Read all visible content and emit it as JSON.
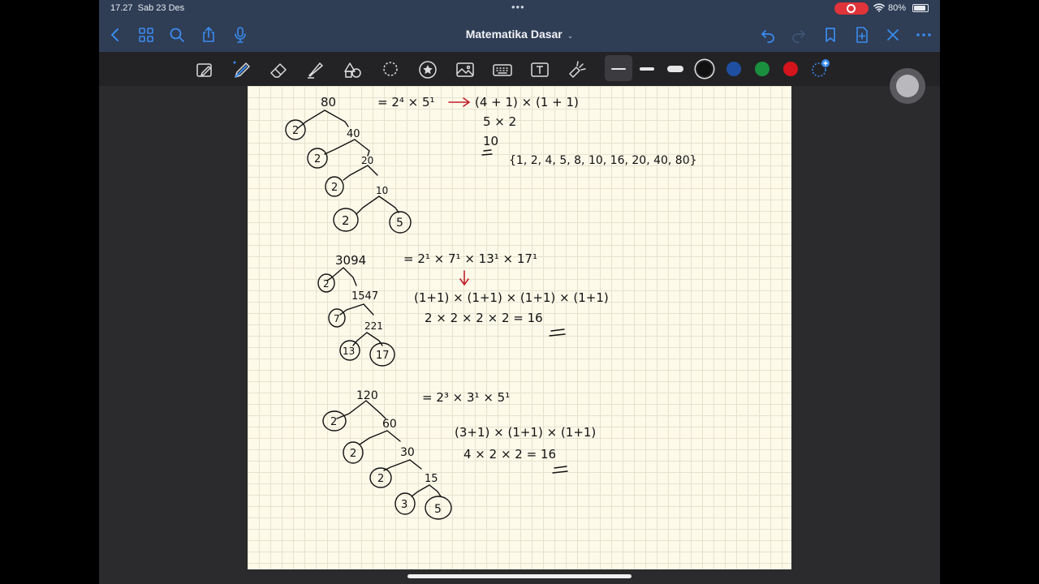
{
  "status": {
    "time": "17.27",
    "date": "Sab 23 Des",
    "dots": "•••",
    "battery": "80%",
    "battery_level": 0.8
  },
  "nav": {
    "title": "Matematika Dasar",
    "title_chevron": "⌄",
    "left_icons": [
      "back-chevron-icon",
      "grid-icon",
      "search-icon",
      "share-icon",
      "microphone-icon"
    ],
    "right_icons": [
      "undo-icon",
      "redo-icon",
      "bookmark-icon",
      "add-page-icon",
      "close-icon",
      "more-icon"
    ]
  },
  "tools": {
    "items": [
      "pen-tool-icon",
      "eraser-icon",
      "highlighter-icon",
      "shapes-icon",
      "lasso-icon",
      "sticker-icon",
      "image-icon",
      "keyboard-icon",
      "text-box-icon",
      "laser-pointer-icon"
    ],
    "active_tool": "pen-tool-icon",
    "stroke_sizes": [
      "thin",
      "medium",
      "thick"
    ],
    "active_stroke": "thin",
    "colors": [
      "#111111",
      "#1f4fa0",
      "#1a8f3e",
      "#d4141c"
    ],
    "active_color": "#111111",
    "accent": "#3a8cf0"
  },
  "notes": {
    "p1": {
      "root": "80",
      "tree": [
        "2",
        "40",
        "2",
        "20",
        "2",
        "10",
        "2",
        "5"
      ],
      "factorization": "= 2⁴ × 5¹",
      "arrow": "⟶",
      "formula": "(4 + 1) × (1 + 1)",
      "product": "5 × 2",
      "result": "10",
      "divisors": "{1, 2, 4, 5, 8, 10, 16, 20, 40, 80}"
    },
    "p2": {
      "root": "3094",
      "tree": [
        "2",
        "1547",
        "7",
        "221",
        "13",
        "17"
      ],
      "factorization": "= 2¹ × 7¹ × 13¹ × 17¹",
      "arrow": "↓",
      "formula": "(1+1) × (1+1) × (1+1) × (1+1)",
      "product": "2 × 2 × 2 × 2 = 16"
    },
    "p3": {
      "root": "120",
      "tree": [
        "2",
        "60",
        "2",
        "30",
        "2",
        "15",
        "3",
        "5"
      ],
      "factorization": "= 2³ × 3¹ × 5¹",
      "formula": "(3+1) × (1+1) × (1+1)",
      "product": "4 × 2 × 2 = 16"
    }
  }
}
